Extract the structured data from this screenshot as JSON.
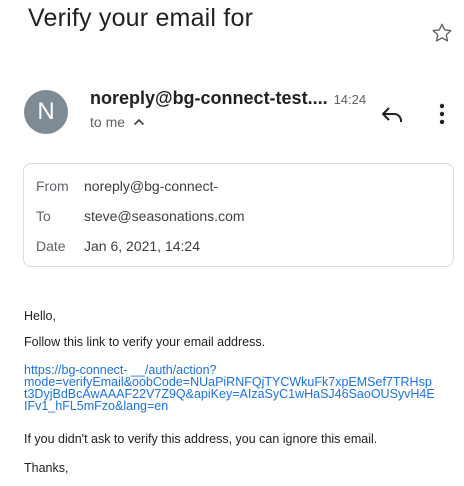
{
  "email": {
    "subject": "Verify your email for",
    "sender": "noreply@bg-connect-test....",
    "time": "14:24",
    "recipient_summary": "to me",
    "details": {
      "from_label": "From",
      "from_value": "noreply@bg-connect-",
      "to_label": "To",
      "to_value": "steve@seasonations.com",
      "date_label": "Date",
      "date_value": "Jan 6, 2021, 14:24"
    },
    "avatar_letter": "N",
    "body": {
      "greeting": "Hello,",
      "instruction": "Follow this link to verify your email address.",
      "link_lines": [
        "https://bg-connect-                          __/auth/action?",
        "mode=verifyEmail&oobCode=NUaPiRNFQjTYCWkuFk7xpEMSef7TRHsp",
        "t3DyjBdBcAwAAAF22V7Z9Q&apiKey=AIzaSyC1wHaSJ46SaoOUSyvH4E",
        "IFv1_hFL5mFzo&lang=en"
      ],
      "ignore_note": "If you didn't ask to verify this address, you can ignore this email.",
      "signoff": "Thanks,"
    }
  },
  "icons": {
    "star": "star-icon",
    "caret": "chevron-up-icon",
    "reply": "reply-icon",
    "more": "more-vertical-icon"
  },
  "colors": {
    "avatar_bg": "#7e8a94",
    "link": "#1a73e8",
    "text_primary": "#202124",
    "text_secondary": "#5f6368"
  }
}
